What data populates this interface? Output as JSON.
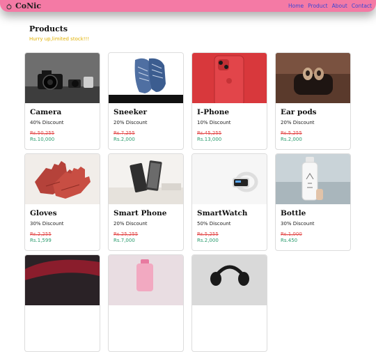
{
  "navbar": {
    "brand": "CoNic",
    "links": [
      "Home",
      "Product",
      "About",
      "Contact"
    ]
  },
  "section": {
    "title": "Products",
    "note": "Hurry up,limited stock!!!"
  },
  "products": [
    {
      "name": "Camera",
      "discount": "40% Discount",
      "old_price": "Rs.50,255",
      "new_price": "Rs.10,000"
    },
    {
      "name": "Sneeker",
      "discount": "20% Discount",
      "old_price": "Rs.7,255",
      "new_price": "Rs.2,000"
    },
    {
      "name": "I-Phone",
      "discount": "10% Discount",
      "old_price": "Rs.45,255",
      "new_price": "Rs.13,000"
    },
    {
      "name": "Ear pods",
      "discount": "20% Discount",
      "old_price": "Rs.5,255",
      "new_price": "Rs.2,000"
    },
    {
      "name": "Gloves",
      "discount": "30% Discount",
      "old_price": "Rs.2,255",
      "new_price": "Rs.1,599"
    },
    {
      "name": "Smart Phone",
      "discount": "20% Discount",
      "old_price": "Rs.25,255",
      "new_price": "Rs.7,000"
    },
    {
      "name": "SmartWatch",
      "discount": "50% Discount",
      "old_price": "Rs.5,255",
      "new_price": "Rs.2,000"
    },
    {
      "name": "Bottle",
      "discount": "30% Discount",
      "old_price": "Rs.1,000",
      "new_price": "Rs.450"
    }
  ],
  "colors": {
    "navbar": "#f47aa5",
    "nav_link": "#3a46d6",
    "note": "#e0b000",
    "old_price": "#e34b4b",
    "new_price": "#2a9b6d"
  }
}
